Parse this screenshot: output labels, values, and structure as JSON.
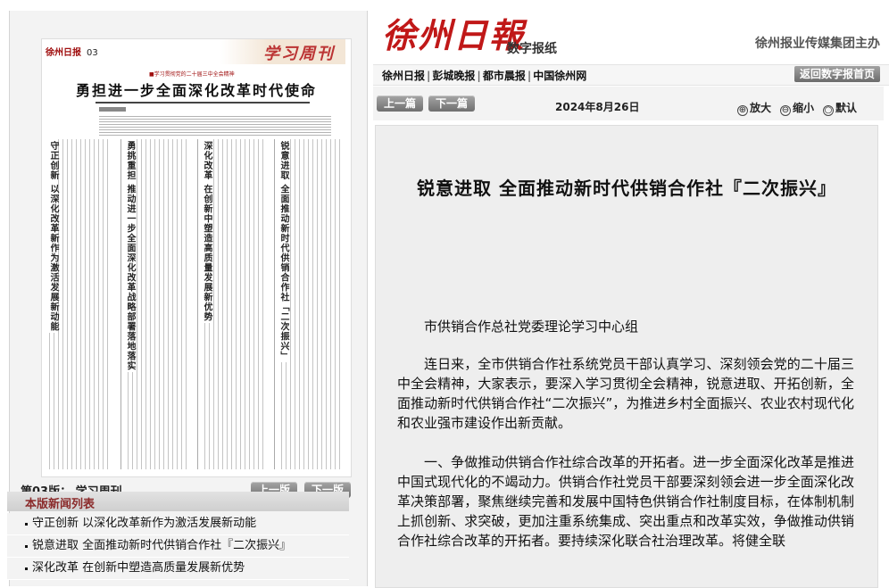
{
  "page": {
    "thumbnail": {
      "masthead": "徐州日报",
      "page_no": "03",
      "column_name": "学习周刊",
      "subheading": "■学习贯彻党的二十届三中全会精神",
      "title": "勇担进一步全面深化改革时代使命",
      "vertical_headlines": [
        "守正创新 以深化改革新作为激活发展新动能",
        "勇挑重担 推动进一步全面深化改革战略部署落地落实",
        "深化改革 在创新中塑造高质量发展新优势",
        "锐意进取 全面推动新时代供销合作社「二次振兴」"
      ]
    },
    "edition": {
      "label": "第03版：  学习周刊",
      "prev_button": "上一版",
      "next_button": "下一版"
    },
    "news_list": {
      "header": "本版新闻列表",
      "items": [
        "守正创新 以深化改革新作为激活发展新动能",
        "锐意进取 全面推动新时代供销合作社『二次振兴』",
        "深化改革 在创新中塑造高质量发展新优势"
      ]
    }
  },
  "banner": {
    "logo": "徐州日報",
    "logo_subtitle": "数字报纸",
    "sponsor": "徐州报业传媒集团主办"
  },
  "nav": {
    "links": [
      "徐州日报",
      "彭城晚报",
      "都市晨报",
      "中国徐州网"
    ],
    "separator": "|",
    "home_button": "返回数字报首页"
  },
  "toolbar": {
    "prev_article": "上一篇",
    "next_article": "下一篇",
    "date": "2024年8月26日",
    "zoom_in": "放大",
    "zoom_out": "缩小",
    "zoom_default": "默认",
    "zoom_in_icon": "⊕",
    "zoom_out_icon": "⊖",
    "zoom_default_icon": "○"
  },
  "article": {
    "title": "锐意进取  全面推动新时代供销合作社『二次振兴』",
    "byline": "市供销合作总社党委理论学习中心组",
    "paragraphs": [
      "连日来，全市供销合作社系统党员干部认真学习、深刻领会党的二十届三中全会精神，大家表示，要深入学习贯彻全会精神，锐意进取、开拓创新，全面推动新时代供销合作社“二次振兴”，为推进乡村全面振兴、农业农村现代化和农业强市建设作出新贡献。",
      "一、争做推动供销合作社综合改革的开拓者。进一步全面深化改革是推进中国式现代化的不竭动力。供销合作社党员干部要深刻领会进一步全面深化改革决策部署，聚焦继续完善和发展中国特色供销合作社制度目标，在体制机制上抓创新、求突破，更加注重系统集成、突出重点和改革实效，争做推动供销合作社综合改革的开拓者。要持续深化联合社治理改革。将健全联"
    ]
  },
  "colors": {
    "brand_red": "#c01818",
    "button_gray": "#8a8a8a",
    "panel_bg": "#f3f3f3",
    "news_header_text": "#8a2a2a"
  }
}
